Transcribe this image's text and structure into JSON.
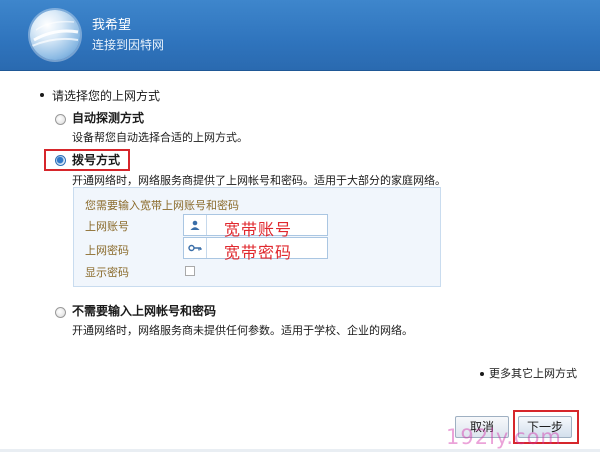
{
  "header": {
    "title": "我希望",
    "subtitle": "连接到因特网"
  },
  "section": {
    "title": "请选择您的上网方式"
  },
  "options": [
    {
      "label": "自动探测方式",
      "description": "设备帮您自动选择合适的上网方式。",
      "selected": false
    },
    {
      "label": "拨号方式",
      "description": "开通网络时，网络服务商提供了上网帐号和密码。适用于大部分的家庭网络。",
      "selected": true
    },
    {
      "label": "不需要输入上网帐号和密码",
      "description": "开通网络时，网络服务商未提供任何参数。适用于学校、企业的网络。",
      "selected": false
    }
  ],
  "dialup_panel": {
    "title": "您需要输入宽带上网账号和密码",
    "account_label": "上网账号",
    "account_value": "宽带账号",
    "password_label": "上网密码",
    "password_value": "宽带密码",
    "show_password_label": "显示密码",
    "show_password_checked": false
  },
  "more_link": "更多其它上网方式",
  "buttons": {
    "cancel": "取消",
    "next": "下一步"
  },
  "watermark": "192ly.com",
  "colors": {
    "header_blue": "#2f74bd",
    "highlight_red": "#d6262b",
    "panel_bg": "#f1f6fc",
    "field_label": "#8a6a2a"
  },
  "icons": {
    "header": "globe-icon",
    "account_field": "user-icon",
    "password_field": "key-icon"
  }
}
